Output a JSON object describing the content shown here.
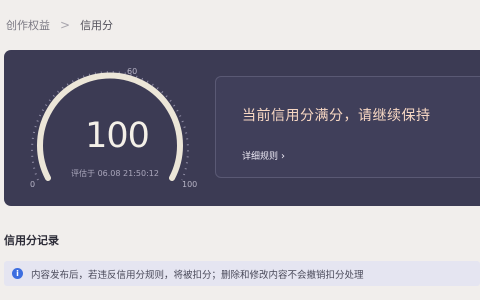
{
  "breadcrumb": {
    "parent": "创作权益",
    "separator": ">",
    "current": "信用分"
  },
  "gauge": {
    "score": "100",
    "score_fraction": 1.0,
    "tick_min": "0",
    "tick_mid": "60",
    "tick_max": "100",
    "eval_time": "评估于 06.08 21:50:12",
    "arc_color": "#ece6d8",
    "tick_color": "#8f8ca4"
  },
  "status": {
    "message": "当前信用分满分，请继续保持",
    "rules_link": "详细规则",
    "rules_chevron": "›"
  },
  "records": {
    "title": "信用分记录",
    "notice_icon": "i",
    "notice": "内容发布后，若违反信用分规则，将被扣分；删除和修改内容不会撤销扣分处理"
  }
}
